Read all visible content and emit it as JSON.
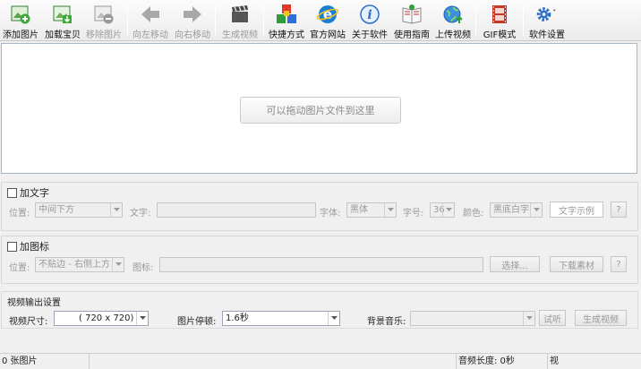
{
  "toolbar": {
    "add_image": "添加图片",
    "load_treasure": "加载宝贝",
    "remove_image": "移除图片",
    "move_left": "向左移动",
    "move_right": "向右移动",
    "generate_video": "生成视频",
    "shortcut": "快捷方式",
    "official_site": "官方网站",
    "about": "关于软件",
    "guide": "使用指南",
    "upload_video": "上传视频",
    "gif_mode": "GIF模式",
    "settings": "软件设置"
  },
  "dropzone": {
    "hint": "可以拖动图片文件到这里"
  },
  "text_panel": {
    "title": "加文字",
    "position_label": "位置:",
    "position_value": "中间下方",
    "text_label": "文字:",
    "font_label": "字体:",
    "font_value": "黑体",
    "size_label": "字号:",
    "size_value": "36",
    "color_label": "颜色:",
    "color_value": "黑底白字",
    "sample_button": "文字示例",
    "help_button": "?"
  },
  "icon_panel": {
    "title": "加图标",
    "position_label": "位置:",
    "position_value": "不贴边 - 右侧上方",
    "icon_label": "图标:",
    "choose_button": "选择...",
    "download_button": "下载素材",
    "help_button": "?"
  },
  "output_panel": {
    "title": "视频输出设置",
    "size_label": "视频尺寸:",
    "size_value": "( 720 x  720)",
    "pause_label": "图片停顿:",
    "pause_value": "1.6秒",
    "music_label": "背景音乐:",
    "partial_button_1": "试听",
    "partial_button_2": "生成视频"
  },
  "status": {
    "image_count": "0 张图片",
    "audio_length": "音频长度: 0秒",
    "video_partial": "视"
  },
  "colors": {
    "add_green": "#3fa83a",
    "arrow_gray": "#a8a8a8",
    "ie_blue": "#1a7fd4",
    "info_blue": "#2a6fc9",
    "gear_blue": "#2d6fc4"
  }
}
